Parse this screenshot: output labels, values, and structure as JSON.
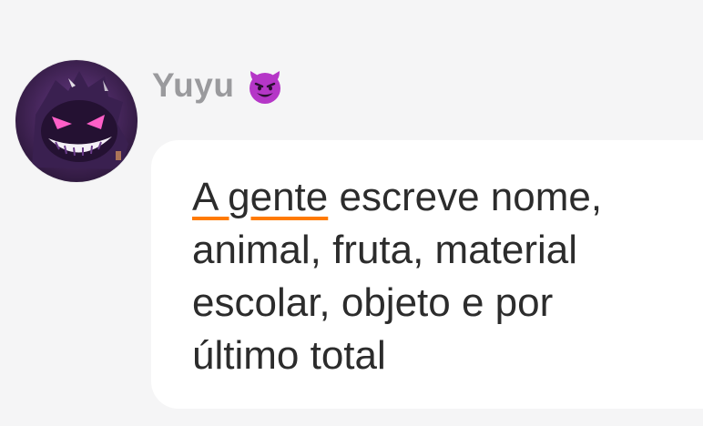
{
  "message": {
    "sender": {
      "name": "Yuyu",
      "emoji_icon": "smiling-devil-icon",
      "avatar": "gengar-avatar"
    },
    "text": {
      "underlined": "A gente",
      "rest_line1": " escreve nome,",
      "line2": "animal, fruta, material",
      "line3": "escolar, objeto e por",
      "line4": "último total"
    },
    "colors": {
      "background": "#f5f5f6",
      "bubble": "#ffffff",
      "sender_name": "#9a9a9d",
      "text": "#2c2c2c",
      "underline": "#ff7a00",
      "emoji": "#b536c7"
    }
  }
}
